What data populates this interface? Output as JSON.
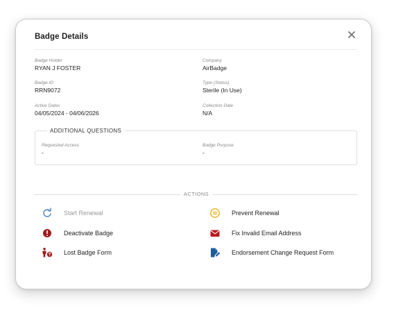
{
  "modal": {
    "title": "Badge Details"
  },
  "details": {
    "badge_holder": {
      "label": "Badge Holder",
      "value": "RYAN J FOSTER"
    },
    "company": {
      "label": "Company",
      "value": "AirBadge"
    },
    "badge_id": {
      "label": "Badge ID",
      "value": "RRN9072"
    },
    "type_status": {
      "label": "Type (Status)",
      "value": "Sterile (In Use)"
    },
    "active_dates": {
      "label": "Active Dates",
      "value": "04/05/2024 - 04/06/2026"
    },
    "collection_date": {
      "label": "Collection Date",
      "value": "N/A"
    }
  },
  "additional_questions": {
    "legend": "ADDITIONAL QUESTIONS",
    "requested_access": {
      "label": "Requested Access",
      "value": "-"
    },
    "badge_purpose": {
      "label": "Badge Purpose",
      "value": "-"
    }
  },
  "actions": {
    "label": "ACTIONS",
    "items": [
      {
        "label": "Start Renewal",
        "icon": "refresh-icon",
        "color": "#5b8fc7",
        "enabled": false
      },
      {
        "label": "Prevent Renewal",
        "icon": "pause-circle-icon",
        "color": "#e8b21c",
        "enabled": true
      },
      {
        "label": "Deactivate Badge",
        "icon": "alert-circle-icon",
        "color": "#a11b1b",
        "enabled": true
      },
      {
        "label": "Fix Invalid Email Address",
        "icon": "envelope-icon",
        "color": "#b8191f",
        "enabled": true
      },
      {
        "label": "Lost Badge Form",
        "icon": "person-question-icon",
        "color": "#a11b1b",
        "enabled": true
      },
      {
        "label": "Endorsement Change Request Form",
        "icon": "file-edit-icon",
        "color": "#1f5c9b",
        "enabled": true
      }
    ]
  }
}
